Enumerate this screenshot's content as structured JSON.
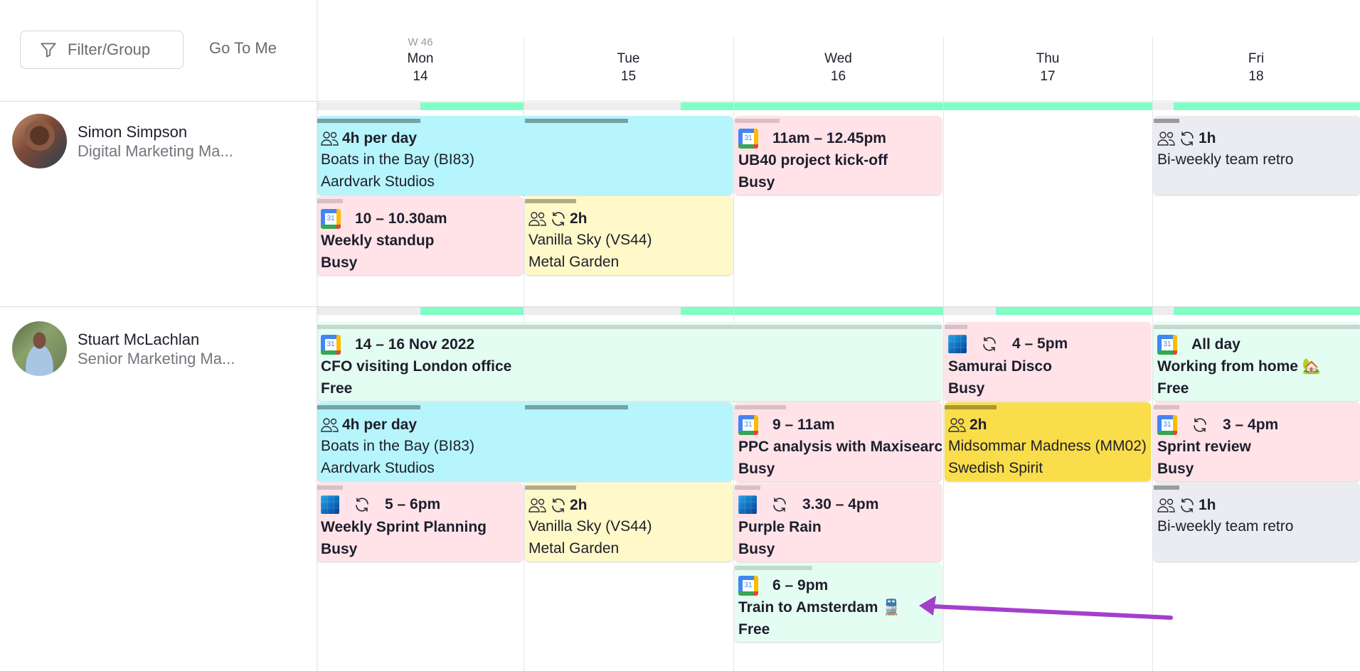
{
  "toolbar": {
    "filter_label": "Filter/Group",
    "goto_label": "Go To Me"
  },
  "week": {
    "label": "W 46",
    "days": [
      {
        "dow": "Mon",
        "num": "14"
      },
      {
        "dow": "Tue",
        "num": "15"
      },
      {
        "dow": "Wed",
        "num": "16"
      },
      {
        "dow": "Thu",
        "num": "17"
      },
      {
        "dow": "Fri",
        "num": "18"
      }
    ]
  },
  "people": [
    {
      "name": "Simon Simpson",
      "role": "Digital Marketing Ma...",
      "capacity_booked_fraction": [
        0.5,
        0.25,
        1.0,
        1.0,
        0.9
      ],
      "events": [
        {
          "kind": "project",
          "color": "cyan",
          "icons": [
            "people-icon"
          ],
          "time": "4h per day",
          "title": "Boats in the Bay (BI83)",
          "sub": "Aardvark Studios",
          "days": "Mon–Tue"
        },
        {
          "kind": "calendar",
          "color": "pink",
          "source": "google-calendar",
          "recurring": false,
          "time": "11am – 12.45pm",
          "title": "UB40 project kick-off",
          "sub": "Busy",
          "days": "Wed"
        },
        {
          "kind": "project",
          "color": "grey",
          "icons": [
            "people-icon",
            "sync-icon"
          ],
          "time": "1h",
          "title": "Bi-weekly team retro",
          "sub": "",
          "days": "Fri"
        },
        {
          "kind": "calendar",
          "color": "pink",
          "source": "google-calendar",
          "recurring": false,
          "time": "10 – 10.30am",
          "title": "Weekly standup",
          "sub": "Busy",
          "days": "Mon"
        },
        {
          "kind": "project",
          "color": "yellow",
          "icons": [
            "people-icon",
            "sync-icon"
          ],
          "time": "2h",
          "title": "Vanilla Sky (VS44)",
          "sub": "Metal Garden",
          "days": "Tue"
        }
      ]
    },
    {
      "name": "Stuart McLachlan",
      "role": "Senior Marketing Ma...",
      "capacity_booked_fraction": [
        0.5,
        0.25,
        1.0,
        0.75,
        0.9
      ],
      "events": [
        {
          "kind": "calendar",
          "color": "mint",
          "source": "google-calendar",
          "recurring": false,
          "time": "14 – 16 Nov 2022",
          "title": "CFO visiting London office",
          "sub": "Free",
          "days": "Mon–Wed"
        },
        {
          "kind": "calendar",
          "color": "pink",
          "source": "outlook",
          "recurring": true,
          "time": "4 – 5pm",
          "title": "Samurai Disco",
          "sub": "Busy",
          "days": "Thu"
        },
        {
          "kind": "calendar",
          "color": "mint",
          "source": "google-calendar",
          "recurring": false,
          "time": "All day",
          "title": "Working from home 🏡",
          "sub": "Free",
          "days": "Fri"
        },
        {
          "kind": "project",
          "color": "cyan",
          "icons": [
            "people-icon"
          ],
          "time": "4h per day",
          "title": "Boats in the Bay (BI83)",
          "sub": "Aardvark Studios",
          "days": "Mon–Tue"
        },
        {
          "kind": "calendar",
          "color": "pink",
          "source": "google-calendar",
          "recurring": false,
          "time": "9 – 11am",
          "title": "PPC analysis with Maxisearch",
          "sub": "Busy",
          "days": "Wed"
        },
        {
          "kind": "project",
          "color": "gold",
          "icons": [
            "people-icon"
          ],
          "time": "2h",
          "title": "Midsommar Madness (MM02)",
          "sub": "Swedish Spirit",
          "days": "Thu"
        },
        {
          "kind": "calendar",
          "color": "pink",
          "source": "google-calendar",
          "recurring": true,
          "time": "3 – 4pm",
          "title": "Sprint review",
          "sub": "Busy",
          "days": "Fri"
        },
        {
          "kind": "calendar",
          "color": "pink",
          "source": "outlook",
          "recurring": true,
          "time": "5 – 6pm",
          "title": "Weekly Sprint Planning",
          "sub": "Busy",
          "days": "Mon"
        },
        {
          "kind": "project",
          "color": "yellow",
          "icons": [
            "people-icon",
            "sync-icon"
          ],
          "time": "2h",
          "title": "Vanilla Sky (VS44)",
          "sub": "Metal Garden",
          "days": "Tue"
        },
        {
          "kind": "calendar",
          "color": "pink",
          "source": "outlook",
          "recurring": true,
          "time": "3.30 – 4pm",
          "title": "Purple Rain",
          "sub": "Busy",
          "days": "Wed"
        },
        {
          "kind": "project",
          "color": "grey",
          "icons": [
            "people-icon",
            "sync-icon"
          ],
          "time": "1h",
          "title": "Bi-weekly team retro",
          "sub": "",
          "days": "Fri"
        },
        {
          "kind": "calendar",
          "color": "mint",
          "source": "google-calendar",
          "recurring": false,
          "time": "6 – 9pm",
          "title": "Train to Amsterdam 🚆",
          "sub": "Free",
          "days": "Wed"
        }
      ]
    }
  ],
  "gcal_day": "31",
  "annotation": {
    "type": "arrow",
    "color": "#a43fcc",
    "points_to": "Train to Amsterdam event"
  }
}
